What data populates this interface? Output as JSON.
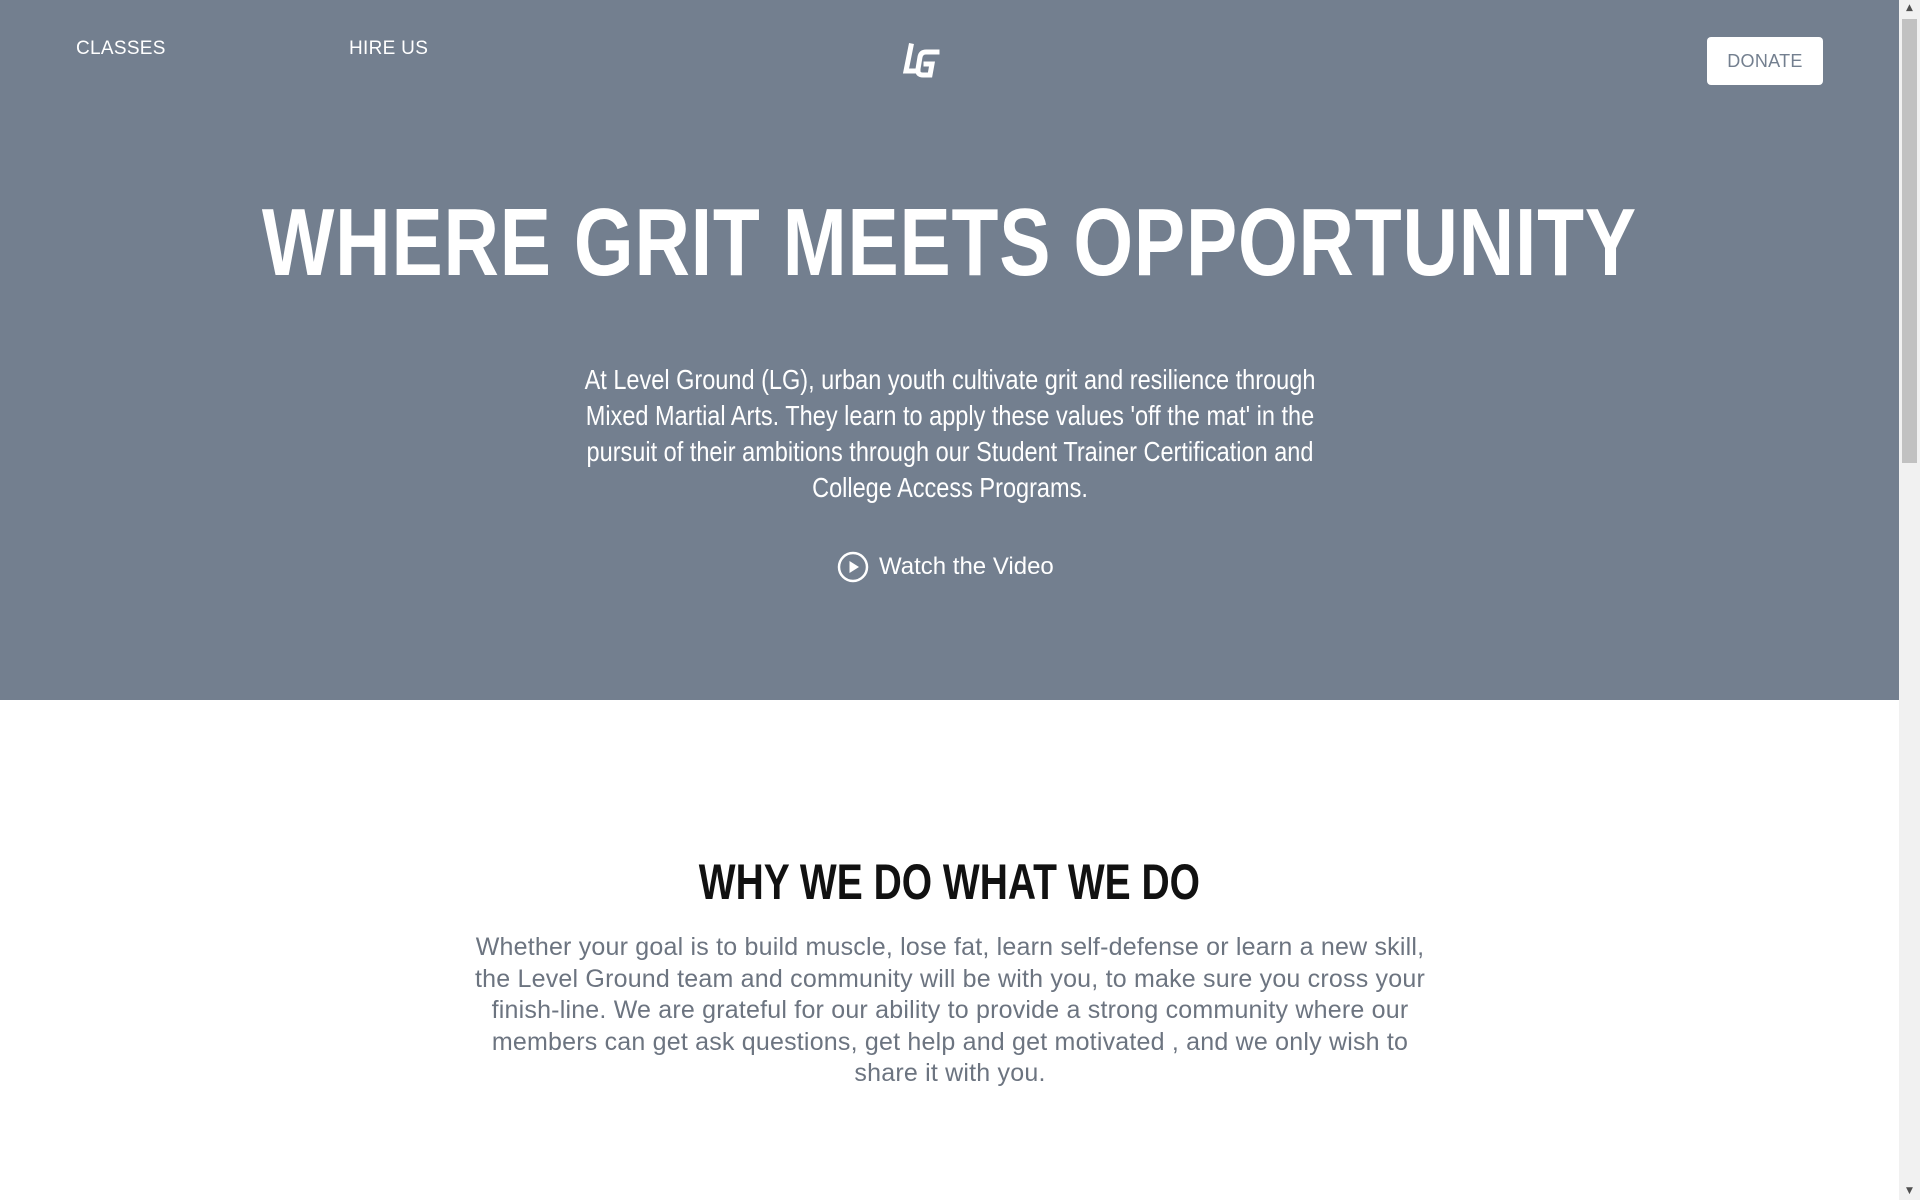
{
  "nav": {
    "classes_label": "CLASSES",
    "hire_label": "HIRE US",
    "logo_text": "LG",
    "donate_label": "DONATE"
  },
  "hero": {
    "title": "WHERE GRIT MEETS OPPORTUNITY",
    "text": "At Level Ground (LG), urban youth cultivate grit and resilience through Mixed Martial Arts. They learn to apply these values 'off the mat' in the pursuit of their ambitions through our Student Trainer Certification and College Access Programs.",
    "video_label": "Watch the Video",
    "video_icon": "play-circle-icon",
    "background_color": "#737f8f"
  },
  "why": {
    "title": "WHY WE DO WHAT WE DO",
    "text": "Whether your goal is to build muscle, lose fat, learn self-defense or learn a new skill, the Level Ground team and community will be with you, to make sure you cross your finish-line. We are grateful for our ability to provide a strong community where our members can get ask questions, get help and get motivated , and we only wish to share it with you."
  },
  "scrollbar": {
    "up_icon": "scroll-up-arrow-icon",
    "down_icon": "scroll-down-arrow-icon"
  }
}
